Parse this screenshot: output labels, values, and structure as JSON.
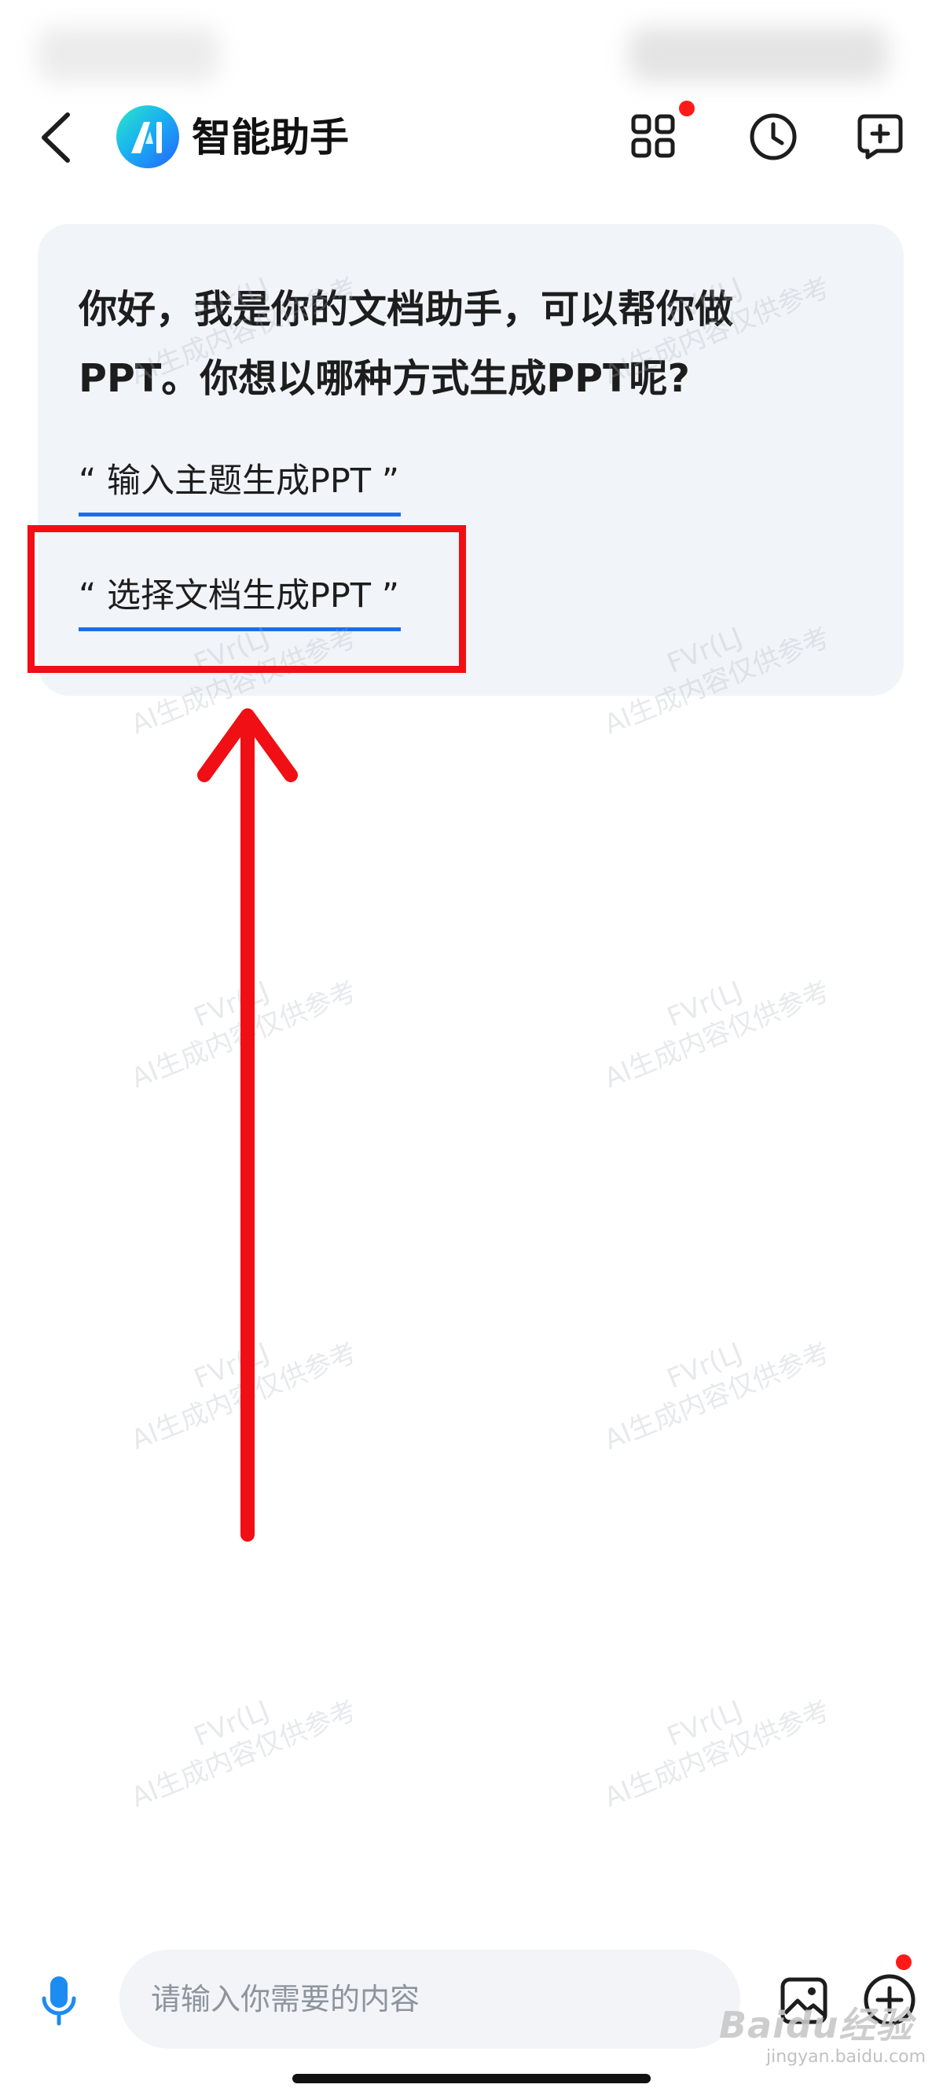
{
  "header": {
    "title": "智能助手",
    "app_logo_letter": "A",
    "icons": {
      "back": "chevron-left-icon",
      "apps": "grid-apps-icon",
      "history": "clock-icon",
      "new_chat": "add-chat-icon"
    },
    "apps_has_notification": true
  },
  "chat": {
    "greeting": "你好，我是你的文档助手，可以帮你做PPT。你想以哪种方式生成PPT呢?",
    "options": [
      {
        "label": "“ 输入主题生成PPT ”"
      },
      {
        "label": "“ 选择文档生成PPT ”"
      }
    ],
    "highlighted_option_index": 1
  },
  "watermark": {
    "line1": "FVr(LJ",
    "line2": "AI生成内容仅供参考"
  },
  "composer": {
    "placeholder": "请输入你需要的内容",
    "value": "",
    "plus_has_notification": true
  },
  "colors": {
    "accent": "#1a6fe8",
    "annotation_red": "#ef0f14",
    "card_bg": "#f1f4f8",
    "notification": "#ff1a1a"
  },
  "source_watermark": {
    "brand": "Baidu经验",
    "domain": "jingyan.baidu.com"
  }
}
